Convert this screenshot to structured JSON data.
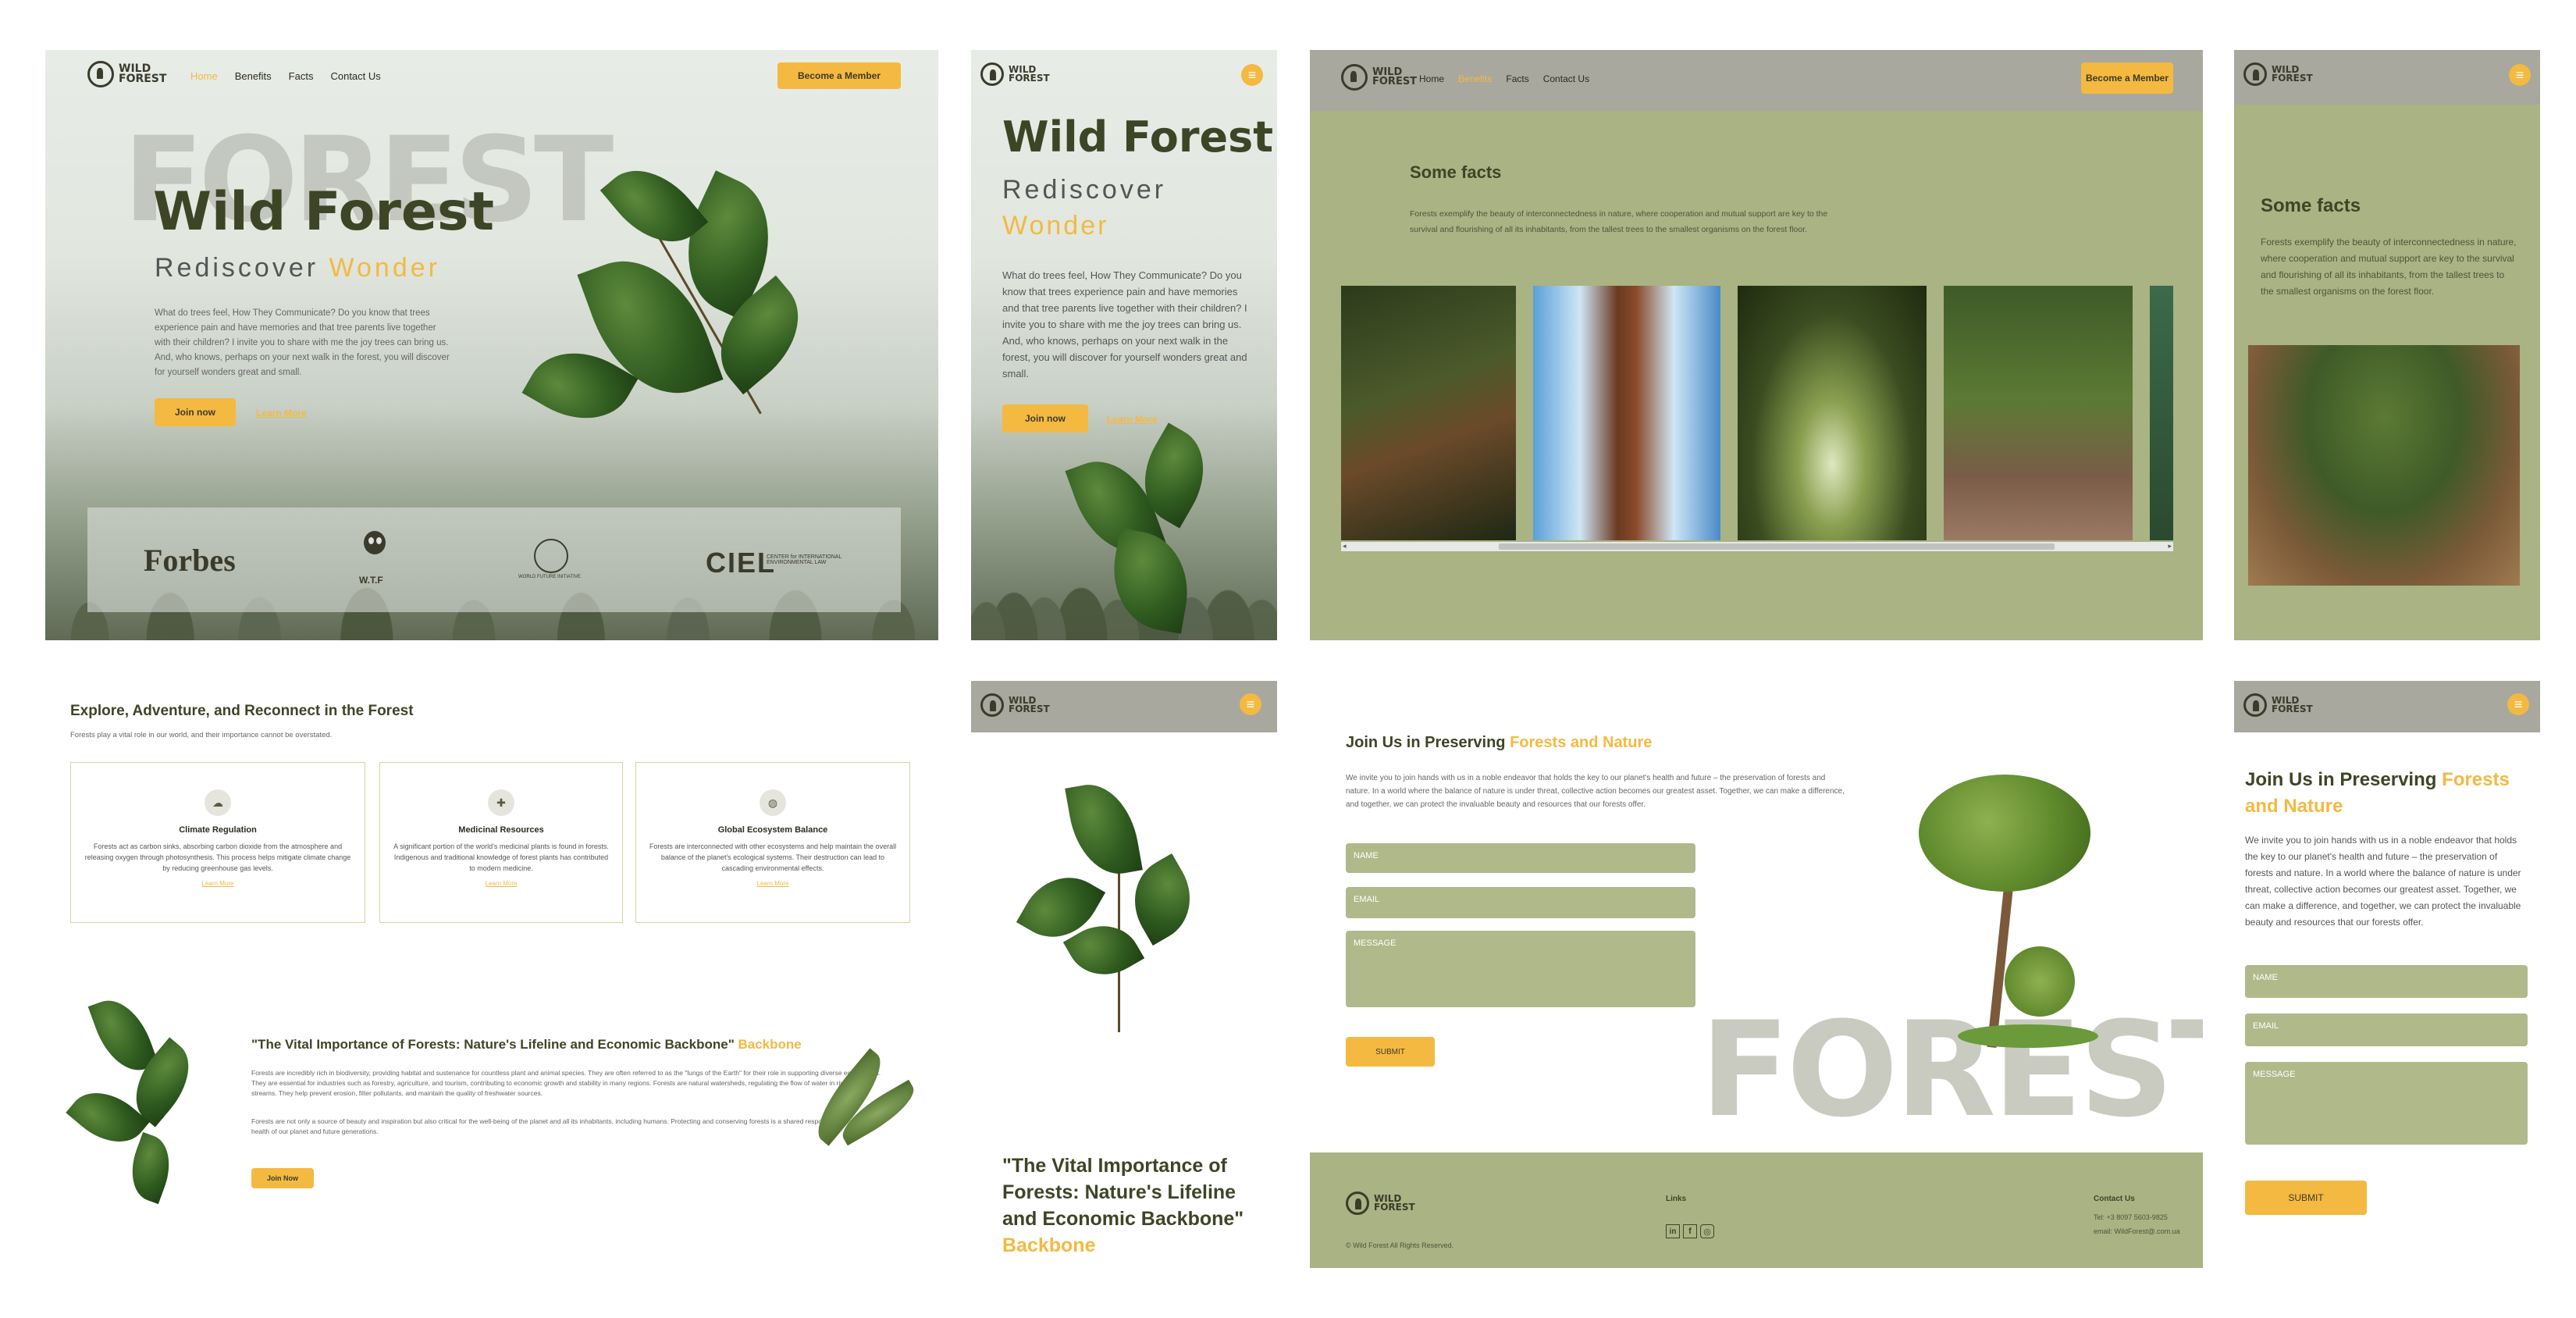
{
  "brand": {
    "line1": "WILD",
    "line2": "FOREST"
  },
  "nav": {
    "home": "Home",
    "benefits": "Benefits",
    "facts": "Facts",
    "contact": "Contact Us",
    "cta": "Become a Member"
  },
  "hero": {
    "bg_word": "FOREST",
    "title": "Wild Forest",
    "subtitle_a": "Rediscover",
    "subtitle_b": "Wonder",
    "body": "What do trees feel, How They Communicate? Do you know that trees experience pain and have memories and that tree parents live together with their children? I invite you to share with me the joy trees can bring us. And, who knows, perhaps on your next walk in the forest, you will discover for yourself wonders great and small.",
    "join": "Join now",
    "learn": "Learn More",
    "partners": {
      "forbes": "Forbes",
      "wwf": "W.T.F",
      "wfi": "WORLD FUTURE INITIATIVE",
      "ciel_logo": "CIEL",
      "ciel_text": "CENTER for INTERNATIONAL ENVIRONMENTAL LAW"
    }
  },
  "mobile_hero": {
    "title": "Wild Forest",
    "subtitle_a": "Rediscover",
    "subtitle_b": "Wonder",
    "body": "What do trees feel, How They Communicate? Do you know that trees experience pain and have memories and that tree parents live together with their children? I invite you to share with me the joy trees can bring us. And, who knows, perhaps on your next walk in the forest, you will discover for yourself wonders great and small.",
    "join": "Join now",
    "learn": "Learn More"
  },
  "facts": {
    "title": "Some facts",
    "body": "Forests exemplify the beauty of interconnectedness in nature, where cooperation and mutual support are key to the survival and flourishing of all its inhabitants, from the tallest trees to the smallest organisms on the forest floor."
  },
  "explore": {
    "title": "Explore, Adventure, and Reconnect in the Forest",
    "sub": "Forests play a vital role in our world, and their importance cannot be overstated.",
    "cards": [
      {
        "title": "Climate Regulation",
        "text": "Forests act as carbon sinks, absorbing carbon dioxide from the atmosphere and releasing oxygen through photosynthesis. This process helps mitigate climate change by reducing greenhouse gas levels.",
        "more": "Learn More"
      },
      {
        "title": "Medicinal Resources",
        "text": "A significant portion of the world's medicinal plants is found in forests. Indigenous and traditional knowledge of forest plants has contributed to modern medicine.",
        "more": "Learn More"
      },
      {
        "title": "Global Ecosystem Balance",
        "text": "Forests are interconnected with other ecosystems and help maintain the overall balance of the planet's ecological systems. Their destruction can lead to cascading environmental effects.",
        "more": "Learn More"
      }
    ]
  },
  "vital": {
    "title": "\"The Vital Importance of Forests: Nature's Lifeline and Economic Backbone\"",
    "accent": "Backbone",
    "p1": "Forests are incredibly rich in biodiversity, providing habitat and sustenance for countless plant and animal species. They are often referred to as the \"lungs of the Earth\" for their role in supporting diverse ecosystems. They are essential for industries such as forestry, agriculture, and tourism, contributing to economic growth and stability in many regions. Forests are natural watersheds, regulating the flow of water in rivers and streams. They help prevent erosion, filter pollutants, and maintain the quality of freshwater sources.",
    "p2": "Forests are not only a source of beauty and inspiration but also critical for the well-being of the planet and all its inhabitants, including humans. Protecting and conserving forests is a shared responsibility to ensure the health of our planet and future generations.",
    "join": "Join Now"
  },
  "mobile_vital": {
    "line1": "\"The Vital Importance of",
    "line2": "Forests: Nature's Lifeline",
    "line3": "and Economic Backbone\"",
    "accent": "Backbone"
  },
  "join": {
    "title_a": "Join Us in Preserving ",
    "title_b": "Forests and Nature",
    "body": "We invite you to join hands with us in a noble endeavor that holds the key to our planet's health and future – the preservation of forests and nature. In a world where the balance of nature is under threat, collective action becomes our greatest asset. Together, we can make a difference, and together, we can protect the invaluable beauty and resources that our forests offer.",
    "name": "NAME",
    "email": "EMAIL",
    "message": "MESSAGE",
    "submit": "SUBMIT",
    "bg_word": "FOREST"
  },
  "footer": {
    "copyright": "© Wild Forest All Rights Reserved.",
    "links": "Links",
    "contact": "Contact Us",
    "tel": "Tel: +3 8097 5603-9825",
    "email": "email: WildForest@.com.ua"
  },
  "icons": {
    "linkedin": "in",
    "facebook": "f",
    "instagram": "◎"
  },
  "colors": {
    "olive": "#a9b383",
    "yellow": "#f4b941",
    "header_grey": "#a8a89e"
  }
}
